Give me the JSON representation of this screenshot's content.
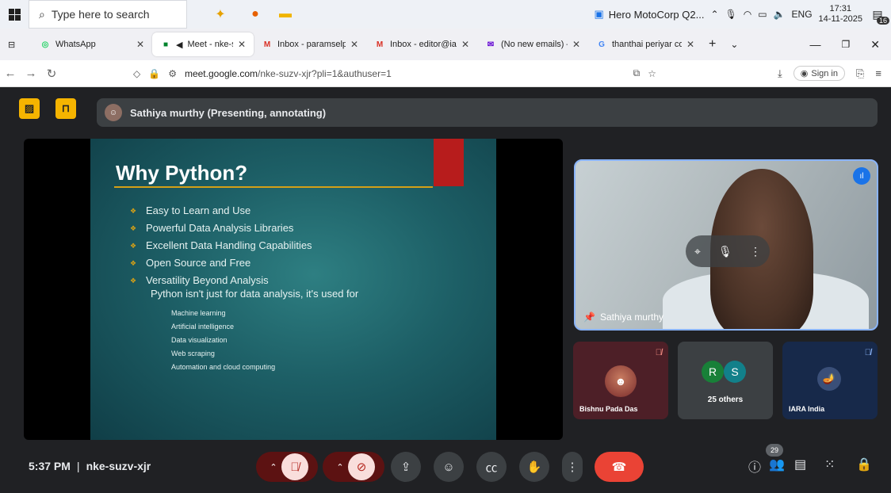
{
  "taskbar": {
    "search_placeholder": "Type here to search",
    "news": "Hero MotoCorp Q2...",
    "lang": "ENG",
    "time": "17:31",
    "date": "14-11-2025",
    "notifications": "16"
  },
  "tabs": [
    {
      "label": "WhatsApp",
      "icon": "whatsapp-icon"
    },
    {
      "label": "Meet - nke-suz",
      "icon": "meet-icon"
    },
    {
      "label": "Inbox - paramselp@",
      "icon": "gmail-icon"
    },
    {
      "label": "Inbox - editor@iara",
      "icon": "gmail-icon"
    },
    {
      "label": "(No new emails) – p",
      "icon": "mail-icon"
    },
    {
      "label": "thanthai periyar coll",
      "icon": "google-icon"
    }
  ],
  "address": {
    "domain": "meet.google.com",
    "path": "/nke-suzv-xjr?pli=1&authuser=1",
    "sign_in": "Sign in"
  },
  "meet": {
    "presenter_label": "Sathiya murthy (Presenting, annotating)",
    "self_name": "Sathiya murthy",
    "meeting_time": "5:37 PM",
    "meeting_code": "nke-suzv-xjr",
    "people_count": "29"
  },
  "slide": {
    "title": "Why Python?",
    "bullets": [
      "Easy to Learn and Use",
      "Powerful Data Analysis Libraries",
      "Excellent Data Handling Capabilities",
      "Open Source and Free",
      "Versatility Beyond Analysis"
    ],
    "subheading": "Python isn't just for data analysis,  it's used for",
    "subitems": [
      "Machine learning",
      "Artificial intelligence",
      "Data visualization",
      "Web scraping",
      "Automation and cloud computing"
    ]
  },
  "participants": [
    {
      "name": "Bishnu Pada Das"
    },
    {
      "name": "25 others",
      "initials": [
        "R",
        "S"
      ]
    },
    {
      "name": "IARA India"
    }
  ],
  "colors": {
    "meet_bg": "#202124",
    "accent": "#f5b400",
    "hangup": "#ea4335"
  }
}
